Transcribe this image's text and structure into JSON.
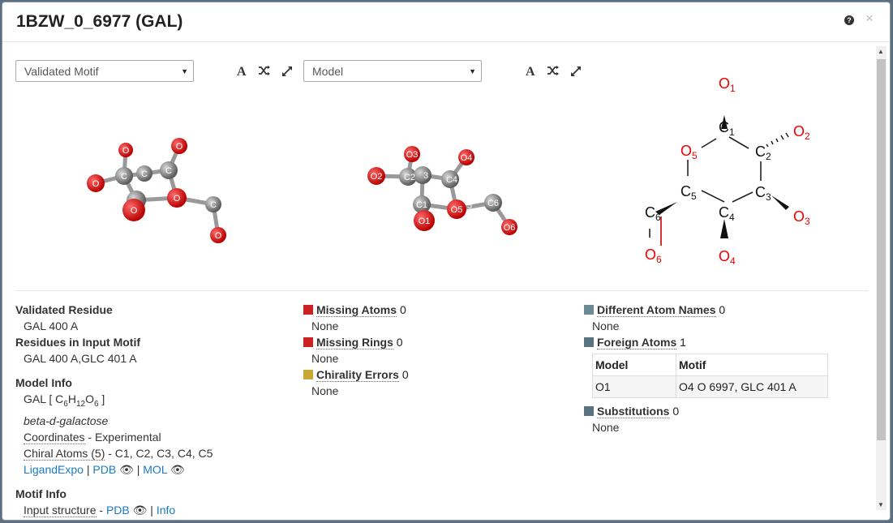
{
  "header": {
    "title": "1BZW_0_6977 (GAL)"
  },
  "left_viewer": {
    "select_value": "Validated Motif",
    "atom_labels": [
      "O",
      "O",
      "O",
      "C",
      "C",
      "O",
      "C",
      "O",
      "C",
      "O"
    ]
  },
  "middle_viewer": {
    "select_value": "Model",
    "atom_labels": [
      "O3",
      "O4",
      "O2",
      "C2",
      "C3",
      "C4",
      "O1",
      "O5",
      "C1",
      "C6",
      "O6",
      "5",
      "3"
    ]
  },
  "diagram": {
    "atom_symbols": [
      "O",
      "O",
      "O",
      "O",
      "O",
      "O",
      "C",
      "C",
      "C",
      "C",
      "C",
      "C"
    ],
    "atom_indices": [
      "1",
      "2",
      "3",
      "4",
      "5",
      "6",
      "1",
      "2",
      "3",
      "4",
      "5",
      "6"
    ]
  },
  "info": {
    "validated_residue_label": "Validated Residue",
    "validated_residue_value": "GAL 400 A",
    "input_motif_label": "Residues in Input Motif",
    "input_motif_value": "GAL 400 A,GLC 401 A",
    "model_info_label": "Model Info",
    "formula_prefix": "GAL [ C",
    "formula_c": "6",
    "formula_h_sym": "H",
    "formula_h": "12",
    "formula_o_sym": "O",
    "formula_o": "6",
    "formula_suffix": " ]",
    "model_name": "beta-d-galactose",
    "coordinates_label": "Coordinates",
    "coordinates_value": " - Experimental",
    "chiral_label": "Chiral Atoms (5)",
    "chiral_value": " - C1, C2, C3, C4, C5",
    "ligandexpo_link": "LigandExpo",
    "pdb_link": "PDB",
    "mol_link": "MOL",
    "sep": " | ",
    "motif_info_label": "Motif Info",
    "input_structure_label": "Input structure",
    "input_structure_dash": " - ",
    "info_link": "Info"
  },
  "middle_col": {
    "missing_atoms_label": "Missing Atoms",
    "missing_atoms_count": "0",
    "missing_atoms_value": "None",
    "missing_rings_label": "Missing Rings",
    "missing_rings_count": "0",
    "missing_rings_value": "None",
    "chirality_label": "Chirality Errors",
    "chirality_count": "0",
    "chirality_value": "None"
  },
  "right_col": {
    "diff_names_label": "Different Atom Names",
    "diff_names_count": "0",
    "diff_names_value": "None",
    "foreign_label": "Foreign Atoms",
    "foreign_count": "1",
    "table_headers": [
      "Model",
      "Motif"
    ],
    "table_row": [
      "O1",
      "O4 O 6997, GLC 401 A"
    ],
    "subst_label": "Substitutions",
    "subst_count": "0",
    "subst_value": "None"
  },
  "colors": {
    "error_red": "#cc2222",
    "warning_gold": "#c8a832",
    "neutral_slate": "#6a8a96",
    "link": "#1a7bc0"
  },
  "icons": [
    "help-icon",
    "close-icon",
    "font-icon",
    "shuffle-icon",
    "expand-icon",
    "eye-icon"
  ]
}
